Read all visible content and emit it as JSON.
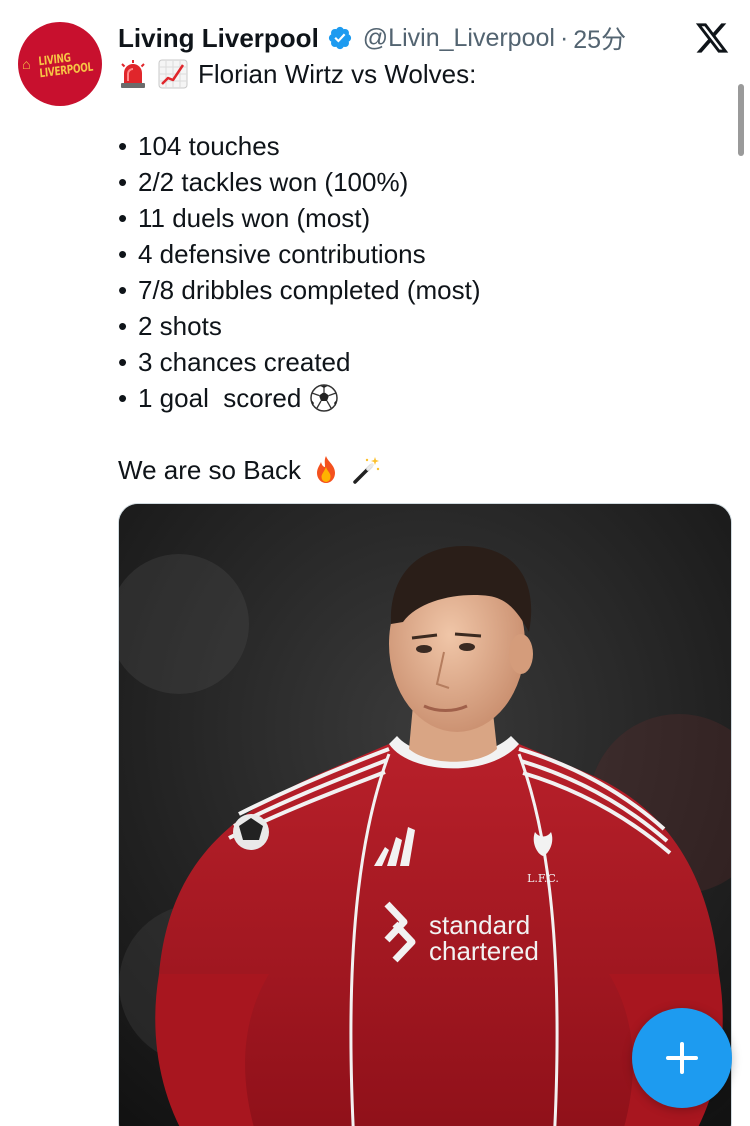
{
  "tweet": {
    "author": {
      "display_name": "Living Liverpool",
      "handle": "@Livin_Liverpool",
      "verified": true,
      "avatar_text": "LIVING\nLIVERPOOL",
      "avatar_color": "#c8102e"
    },
    "separator": "·",
    "time": "25分",
    "headline": "Florian Wirtz vs Wolves:",
    "headline_icons": [
      "siren-emoji-icon",
      "chart-increasing-emoji-icon"
    ],
    "stats": [
      "104 touches",
      "2/2 tackles won (100%)",
      "11 duels won (most)",
      "4 defensive contributions",
      "7/8 dribbles completed (most)",
      "2 shots",
      "3 chances created",
      "1 goal  scored"
    ],
    "closing": "We are so Back",
    "closing_icons": [
      "fire-emoji-icon",
      "magic-wand-emoji-icon"
    ],
    "media": {
      "jersey_sponsor_line1": "standard",
      "jersey_sponsor_line2": "chartered",
      "crest_text": "L.F.C."
    }
  },
  "colors": {
    "accent": "#1d9bf0",
    "liverpool_red": "#c8102e",
    "secondary_text": "#536471"
  },
  "icons": {
    "platform_logo": "x-logo-icon",
    "compose": "plus-icon",
    "verified": "verified-badge-icon"
  }
}
